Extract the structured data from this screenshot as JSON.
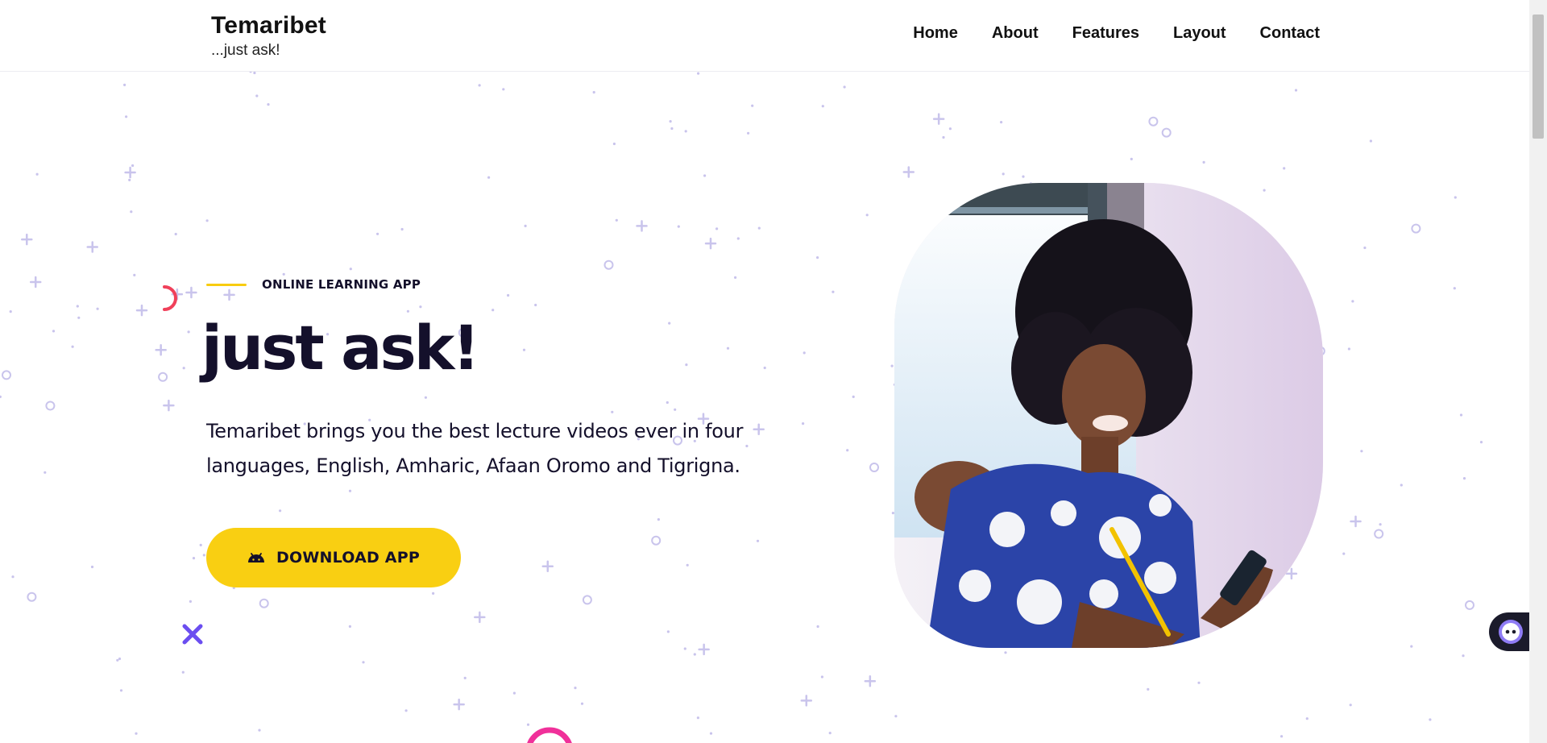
{
  "header": {
    "brand_name": "Temaribet",
    "brand_tagline": "...just ask!",
    "nav": [
      {
        "label": "Home"
      },
      {
        "label": "About"
      },
      {
        "label": "Features"
      },
      {
        "label": "Layout"
      },
      {
        "label": "Contact"
      }
    ]
  },
  "hero": {
    "eyebrow": "ONLINE LEARNING APP",
    "title": "just ask!",
    "description": "Temaribet brings you the best lecture videos ever in four languages, English, Amharic, Afaan Oromo and Tigrigna.",
    "download_button": {
      "label": "DOWNLOAD APP",
      "icon": "android-icon"
    },
    "photo": {
      "subject": "hero-photo"
    }
  },
  "chat_widget": {
    "icon": "chat-bot-icon"
  },
  "colors": {
    "accent_yellow": "#f9cf12",
    "dark_text": "#14102b",
    "decor_purple": "#6b4ef0",
    "decor_red": "#f0405a",
    "decor_pink": "#f0309a",
    "pattern": "#c9c4ec"
  }
}
